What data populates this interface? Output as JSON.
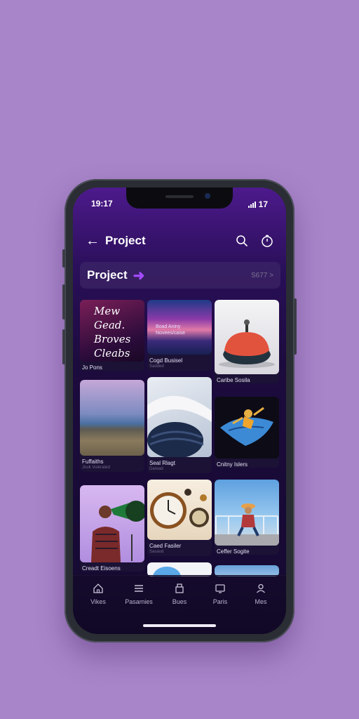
{
  "status": {
    "time": "19:17",
    "right": "17"
  },
  "appbar": {
    "back_icon": "←",
    "title": "Project"
  },
  "banner": {
    "title": "Project",
    "more": "S677 >"
  },
  "cards": [
    {
      "overlay": "Mew\nGead.\nBroves\nCleabs",
      "caption": "Jo Pons",
      "sub": ""
    },
    {
      "overlay": "Boad Aniny\nNovees/caise",
      "caption": "Cogd Busisel",
      "sub": "Sadded"
    },
    {
      "overlay": "",
      "caption": "Caribe Sosila",
      "sub": ""
    },
    {
      "overlay": "",
      "caption": "Fuffaiths",
      "sub": "Jouk Vulerated"
    },
    {
      "overlay": "",
      "caption": "Seal Rlagt",
      "sub": "Daread"
    },
    {
      "overlay": "",
      "caption": "Cnitny Islers",
      "sub": ""
    },
    {
      "overlay": "",
      "caption": "Creadt Eisoens",
      "sub": ""
    },
    {
      "overlay": "",
      "caption": "Caed Fasiler",
      "sub": "Sasaud"
    },
    {
      "overlay": "",
      "caption": "Ceffer Sogite",
      "sub": ""
    }
  ],
  "nav": [
    {
      "label": "Vikes",
      "icon": "home-icon"
    },
    {
      "label": "Pasamies",
      "icon": "list-icon"
    },
    {
      "label": "Bues",
      "icon": "stack-icon"
    },
    {
      "label": "Paris",
      "icon": "tv-icon"
    },
    {
      "label": "Mes",
      "icon": "user-icon"
    }
  ]
}
